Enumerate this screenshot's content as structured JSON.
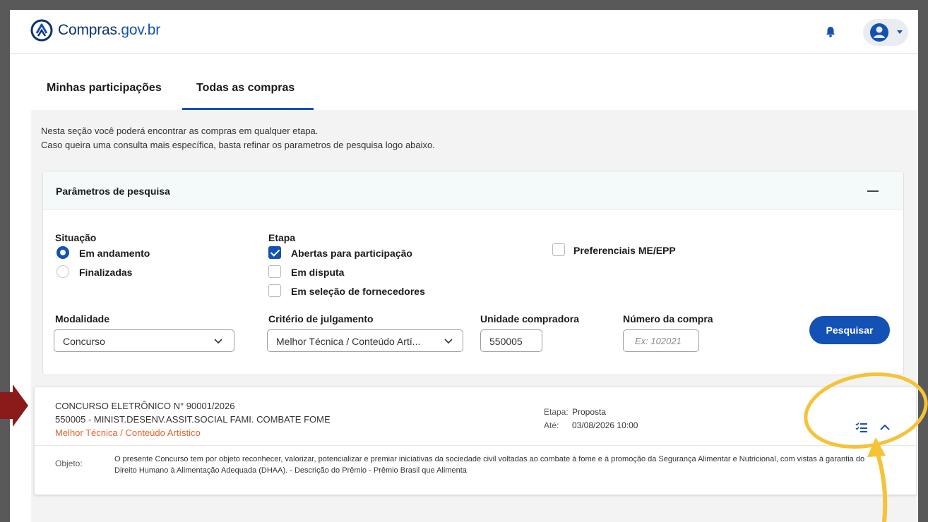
{
  "header": {
    "logo_text_main": "Compras",
    "logo_text_domain": ".gov.br",
    "icons": [
      "logo-icon",
      "bell-icon",
      "user-icon",
      "caret-down-icon"
    ]
  },
  "tabs": [
    {
      "label": "Minhas participações",
      "active": false
    },
    {
      "label": "Todas as compras",
      "active": true
    }
  ],
  "intro": {
    "line1": "Nesta seção você poderá encontrar as compras em qualquer etapa.",
    "line2": "Caso queira uma consulta mais específica, basta refinar os parametros de pesquisa logo abaixo."
  },
  "search": {
    "title": "Parâmetros de pesquisa",
    "situacao": {
      "label": "Situação",
      "options": [
        {
          "label": "Em andamento",
          "selected": true
        },
        {
          "label": "Finalizadas",
          "selected": false
        }
      ]
    },
    "etapa": {
      "label": "Etapa",
      "options": [
        {
          "label": "Abertas para participação",
          "checked": true
        },
        {
          "label": "Em disputa",
          "checked": false
        },
        {
          "label": "Em seleção de fornecedores",
          "checked": false
        }
      ]
    },
    "preferenciais": {
      "label": "Preferenciais ME/EPP",
      "checked": false
    },
    "modalidade": {
      "label": "Modalidade",
      "value": "Concurso"
    },
    "criterio": {
      "label": "Critério de julgamento",
      "value": "Melhor Técnica / Conteúdo Artí..."
    },
    "unidade": {
      "label": "Unidade compradora",
      "value": "550005"
    },
    "numero": {
      "label": "Número da compra",
      "placeholder": "Ex: 102021"
    },
    "button": "Pesquisar"
  },
  "result": {
    "title": "CONCURSO ELETRÔNICO N° 90001/2026",
    "unit": "550005 - MINIST.DESENV.ASSIT.SOCIAL FAMI. COMBATE FOME",
    "criterion": "Melhor Técnica / Conteúdo Artístico",
    "etapa_label": "Etapa:",
    "etapa_value": "Proposta",
    "ate_label": "Até:",
    "ate_value": "03/08/2026 10:00",
    "objeto_label": "Objeto:",
    "objeto_text": "O presente Concurso tem por objeto reconhecer, valorizar, potencializar e premiar iniciativas da sociedade civil voltadas ao combate à fome e à promoção da Segurança Alimentar e Nutricional, com vistas à garantia do Direito Humano à Alimentação Adequada (DHAA). - Descrição do Prêmio - Prêmio Brasil que Alimenta"
  },
  "colors": {
    "primary": "#1351b4",
    "criterion": "#e5612a",
    "annotation_arrow": "#8b1a1a",
    "annotation_highlight": "#f5c238"
  }
}
